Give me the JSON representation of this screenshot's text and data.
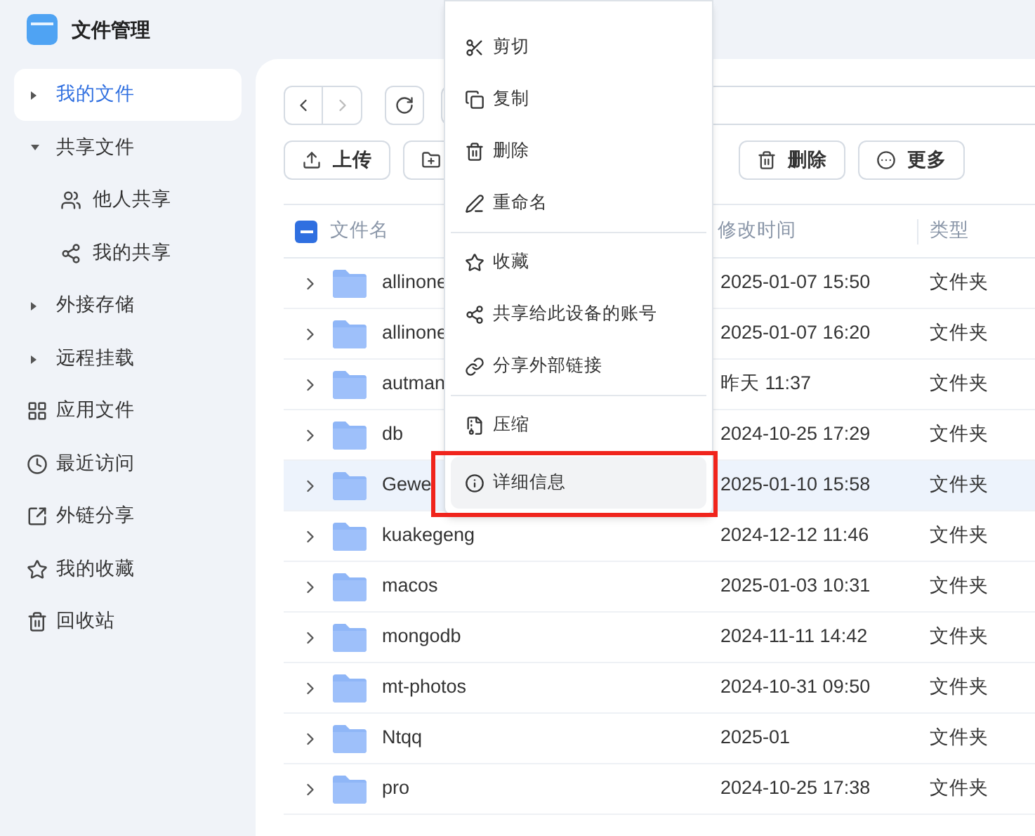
{
  "app": {
    "title": "文件管理"
  },
  "sidebar": {
    "items": [
      {
        "kind": "group",
        "label": "我的文件",
        "selected": true,
        "expanded": false
      },
      {
        "kind": "group",
        "label": "共享文件",
        "selected": false,
        "expanded": true
      },
      {
        "kind": "child",
        "label": "他人共享",
        "selected": false
      },
      {
        "kind": "child",
        "label": "我的共享",
        "selected": false
      },
      {
        "kind": "group",
        "label": "外接存储",
        "selected": false,
        "expanded": false
      },
      {
        "kind": "group",
        "label": "远程挂载",
        "selected": false,
        "expanded": false
      },
      {
        "kind": "link",
        "label": "应用文件",
        "selected": false
      },
      {
        "kind": "link",
        "label": "最近访问",
        "selected": false
      },
      {
        "kind": "link",
        "label": "外链分享",
        "selected": false
      },
      {
        "kind": "link",
        "label": "我的收藏",
        "selected": false
      },
      {
        "kind": "link",
        "label": "回收站",
        "selected": false
      }
    ]
  },
  "toolbar": {
    "buttons": [
      {
        "kind": "upload",
        "label": "上传"
      },
      {
        "kind": "new-folder"
      },
      {
        "kind": "delete",
        "label": "删除"
      },
      {
        "kind": "more",
        "label": "更多"
      }
    ]
  },
  "table": {
    "select_all_partial": true,
    "columns": [
      "文件名",
      "修改时间",
      "类型"
    ],
    "rows": [
      {
        "name": "allinone",
        "modified": "2025-01-07 15:50",
        "type": "文件夹",
        "selected": false
      },
      {
        "name": "allinone",
        "modified": "2025-01-07 16:20",
        "type": "文件夹",
        "selected": false
      },
      {
        "name": "autman",
        "modified": "昨天 11:37",
        "type": "文件夹",
        "selected": false
      },
      {
        "name": "db",
        "modified": "2024-10-25 17:29",
        "type": "文件夹",
        "selected": false
      },
      {
        "name": "Gewe",
        "modified": "2025-01-10 15:58",
        "type": "文件夹",
        "selected": true
      },
      {
        "name": "kuakegeng",
        "modified": "2024-12-12 11:46",
        "type": "文件夹",
        "selected": false
      },
      {
        "name": "macos",
        "modified": "2025-01-03 10:31",
        "type": "文件夹",
        "selected": false
      },
      {
        "name": "mongodb",
        "modified": "2024-11-11 14:42",
        "type": "文件夹",
        "selected": false
      },
      {
        "name": "mt-photos",
        "modified": "2024-10-31 09:50",
        "type": "文件夹",
        "selected": false
      },
      {
        "name": "Ntqq",
        "modified": "2025-01",
        "type": "文件夹",
        "selected": false
      },
      {
        "name": "pro",
        "modified": "2024-10-25 17:38",
        "type": "文件夹",
        "selected": false
      }
    ]
  },
  "context_menu": {
    "groups": [
      [
        {
          "kind": "cut",
          "label": "剪切",
          "selected": false
        },
        {
          "kind": "copy",
          "label": "复制",
          "selected": false
        },
        {
          "kind": "delete",
          "label": "删除",
          "selected": false
        },
        {
          "kind": "rename",
          "label": "重命名",
          "selected": false
        }
      ],
      [
        {
          "kind": "favorite",
          "label": "收藏",
          "selected": false
        },
        {
          "kind": "share",
          "label": "共享给此设备的账号",
          "selected": false
        },
        {
          "kind": "link",
          "label": "分享外部链接",
          "selected": false
        }
      ],
      [
        {
          "kind": "compress",
          "label": "压缩",
          "selected": false
        },
        {
          "kind": "info",
          "label": "详细信息",
          "selected": true
        }
      ]
    ]
  }
}
